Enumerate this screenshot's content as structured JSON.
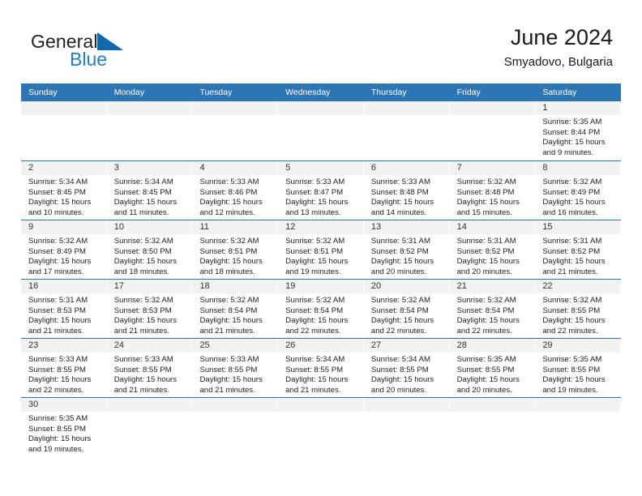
{
  "brand": {
    "name_part1": "General",
    "name_part2": "Blue",
    "flag_icon": "blue-triangle-flag-icon",
    "accent_color": "#1f7fc4"
  },
  "header": {
    "title": "June 2024",
    "subtitle": "Smyadovo, Bulgaria",
    "header_bg_color": "#2e75b6",
    "numband_bg_color": "#f2f2f2"
  },
  "weekdays": [
    "Sunday",
    "Monday",
    "Tuesday",
    "Wednesday",
    "Thursday",
    "Friday",
    "Saturday"
  ],
  "weeks": [
    {
      "days": [
        {
          "empty": true
        },
        {
          "empty": true
        },
        {
          "empty": true
        },
        {
          "empty": true
        },
        {
          "empty": true
        },
        {
          "empty": true
        },
        {
          "num": "1",
          "sunrise": "Sunrise: 5:35 AM",
          "sunset": "Sunset: 8:44 PM",
          "daylight1": "Daylight: 15 hours",
          "daylight2": "and 9 minutes."
        }
      ]
    },
    {
      "days": [
        {
          "num": "2",
          "sunrise": "Sunrise: 5:34 AM",
          "sunset": "Sunset: 8:45 PM",
          "daylight1": "Daylight: 15 hours",
          "daylight2": "and 10 minutes."
        },
        {
          "num": "3",
          "sunrise": "Sunrise: 5:34 AM",
          "sunset": "Sunset: 8:45 PM",
          "daylight1": "Daylight: 15 hours",
          "daylight2": "and 11 minutes."
        },
        {
          "num": "4",
          "sunrise": "Sunrise: 5:33 AM",
          "sunset": "Sunset: 8:46 PM",
          "daylight1": "Daylight: 15 hours",
          "daylight2": "and 12 minutes."
        },
        {
          "num": "5",
          "sunrise": "Sunrise: 5:33 AM",
          "sunset": "Sunset: 8:47 PM",
          "daylight1": "Daylight: 15 hours",
          "daylight2": "and 13 minutes."
        },
        {
          "num": "6",
          "sunrise": "Sunrise: 5:33 AM",
          "sunset": "Sunset: 8:48 PM",
          "daylight1": "Daylight: 15 hours",
          "daylight2": "and 14 minutes."
        },
        {
          "num": "7",
          "sunrise": "Sunrise: 5:32 AM",
          "sunset": "Sunset: 8:48 PM",
          "daylight1": "Daylight: 15 hours",
          "daylight2": "and 15 minutes."
        },
        {
          "num": "8",
          "sunrise": "Sunrise: 5:32 AM",
          "sunset": "Sunset: 8:49 PM",
          "daylight1": "Daylight: 15 hours",
          "daylight2": "and 16 minutes."
        }
      ]
    },
    {
      "days": [
        {
          "num": "9",
          "sunrise": "Sunrise: 5:32 AM",
          "sunset": "Sunset: 8:49 PM",
          "daylight1": "Daylight: 15 hours",
          "daylight2": "and 17 minutes."
        },
        {
          "num": "10",
          "sunrise": "Sunrise: 5:32 AM",
          "sunset": "Sunset: 8:50 PM",
          "daylight1": "Daylight: 15 hours",
          "daylight2": "and 18 minutes."
        },
        {
          "num": "11",
          "sunrise": "Sunrise: 5:32 AM",
          "sunset": "Sunset: 8:51 PM",
          "daylight1": "Daylight: 15 hours",
          "daylight2": "and 18 minutes."
        },
        {
          "num": "12",
          "sunrise": "Sunrise: 5:32 AM",
          "sunset": "Sunset: 8:51 PM",
          "daylight1": "Daylight: 15 hours",
          "daylight2": "and 19 minutes."
        },
        {
          "num": "13",
          "sunrise": "Sunrise: 5:31 AM",
          "sunset": "Sunset: 8:52 PM",
          "daylight1": "Daylight: 15 hours",
          "daylight2": "and 20 minutes."
        },
        {
          "num": "14",
          "sunrise": "Sunrise: 5:31 AM",
          "sunset": "Sunset: 8:52 PM",
          "daylight1": "Daylight: 15 hours",
          "daylight2": "and 20 minutes."
        },
        {
          "num": "15",
          "sunrise": "Sunrise: 5:31 AM",
          "sunset": "Sunset: 8:52 PM",
          "daylight1": "Daylight: 15 hours",
          "daylight2": "and 21 minutes."
        }
      ]
    },
    {
      "days": [
        {
          "num": "16",
          "sunrise": "Sunrise: 5:31 AM",
          "sunset": "Sunset: 8:53 PM",
          "daylight1": "Daylight: 15 hours",
          "daylight2": "and 21 minutes."
        },
        {
          "num": "17",
          "sunrise": "Sunrise: 5:32 AM",
          "sunset": "Sunset: 8:53 PM",
          "daylight1": "Daylight: 15 hours",
          "daylight2": "and 21 minutes."
        },
        {
          "num": "18",
          "sunrise": "Sunrise: 5:32 AM",
          "sunset": "Sunset: 8:54 PM",
          "daylight1": "Daylight: 15 hours",
          "daylight2": "and 21 minutes."
        },
        {
          "num": "19",
          "sunrise": "Sunrise: 5:32 AM",
          "sunset": "Sunset: 8:54 PM",
          "daylight1": "Daylight: 15 hours",
          "daylight2": "and 22 minutes."
        },
        {
          "num": "20",
          "sunrise": "Sunrise: 5:32 AM",
          "sunset": "Sunset: 8:54 PM",
          "daylight1": "Daylight: 15 hours",
          "daylight2": "and 22 minutes."
        },
        {
          "num": "21",
          "sunrise": "Sunrise: 5:32 AM",
          "sunset": "Sunset: 8:54 PM",
          "daylight1": "Daylight: 15 hours",
          "daylight2": "and 22 minutes."
        },
        {
          "num": "22",
          "sunrise": "Sunrise: 5:32 AM",
          "sunset": "Sunset: 8:55 PM",
          "daylight1": "Daylight: 15 hours",
          "daylight2": "and 22 minutes."
        }
      ]
    },
    {
      "days": [
        {
          "num": "23",
          "sunrise": "Sunrise: 5:33 AM",
          "sunset": "Sunset: 8:55 PM",
          "daylight1": "Daylight: 15 hours",
          "daylight2": "and 22 minutes."
        },
        {
          "num": "24",
          "sunrise": "Sunrise: 5:33 AM",
          "sunset": "Sunset: 8:55 PM",
          "daylight1": "Daylight: 15 hours",
          "daylight2": "and 21 minutes."
        },
        {
          "num": "25",
          "sunrise": "Sunrise: 5:33 AM",
          "sunset": "Sunset: 8:55 PM",
          "daylight1": "Daylight: 15 hours",
          "daylight2": "and 21 minutes."
        },
        {
          "num": "26",
          "sunrise": "Sunrise: 5:34 AM",
          "sunset": "Sunset: 8:55 PM",
          "daylight1": "Daylight: 15 hours",
          "daylight2": "and 21 minutes."
        },
        {
          "num": "27",
          "sunrise": "Sunrise: 5:34 AM",
          "sunset": "Sunset: 8:55 PM",
          "daylight1": "Daylight: 15 hours",
          "daylight2": "and 20 minutes."
        },
        {
          "num": "28",
          "sunrise": "Sunrise: 5:35 AM",
          "sunset": "Sunset: 8:55 PM",
          "daylight1": "Daylight: 15 hours",
          "daylight2": "and 20 minutes."
        },
        {
          "num": "29",
          "sunrise": "Sunrise: 5:35 AM",
          "sunset": "Sunset: 8:55 PM",
          "daylight1": "Daylight: 15 hours",
          "daylight2": "and 19 minutes."
        }
      ]
    },
    {
      "days": [
        {
          "num": "30",
          "sunrise": "Sunrise: 5:35 AM",
          "sunset": "Sunset: 8:55 PM",
          "daylight1": "Daylight: 15 hours",
          "daylight2": "and 19 minutes."
        },
        {
          "empty": true
        },
        {
          "empty": true
        },
        {
          "empty": true
        },
        {
          "empty": true
        },
        {
          "empty": true
        },
        {
          "empty": true
        }
      ]
    }
  ]
}
